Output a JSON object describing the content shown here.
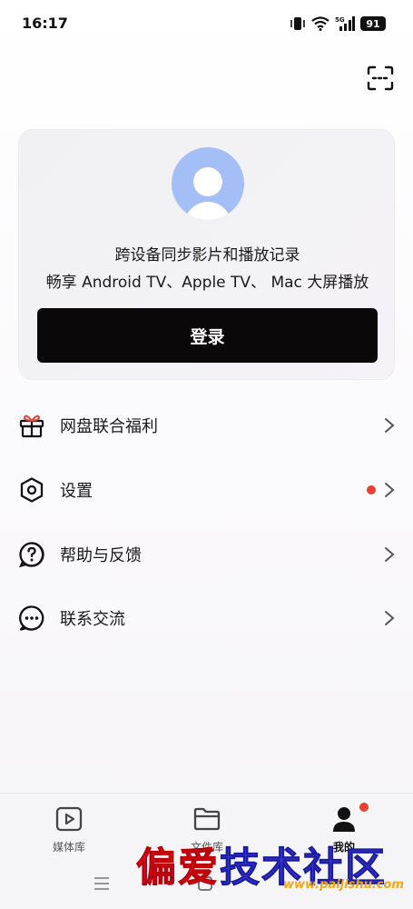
{
  "status_bar": {
    "time": "16:17",
    "network": "5G",
    "battery": "91"
  },
  "header": {
    "scan_icon": "scan-icon"
  },
  "login_card": {
    "avatar_icon": "user-avatar-icon",
    "line1": "跨设备同步影片和播放记录",
    "line2": "畅享 Android TV、Apple TV、 Mac 大屏播放",
    "login_label": "登录"
  },
  "menu": {
    "items": [
      {
        "icon": "gift-icon",
        "label": "网盘联合福利",
        "has_badge": false
      },
      {
        "icon": "settings-icon",
        "label": "设置",
        "has_badge": true
      },
      {
        "icon": "help-icon",
        "label": "帮助与反馈",
        "has_badge": false
      },
      {
        "icon": "chat-icon",
        "label": "联系交流",
        "has_badge": false
      }
    ]
  },
  "bottom_nav": {
    "tabs": [
      {
        "icon": "play-icon",
        "label": "媒体库",
        "active": false
      },
      {
        "icon": "folder-icon",
        "label": "文件库",
        "active": false
      },
      {
        "icon": "person-icon",
        "label": "我的",
        "active": true
      }
    ]
  },
  "watermark": {
    "text_red1": "偏",
    "text_red2": "爱",
    "text_blue": "技",
    "text_rest": "术社区",
    "url": "www.paijishu.com"
  },
  "colors": {
    "accent_dark": "#0a0809",
    "badge_red": "#e8412f",
    "avatar_blue": "#a4bff5"
  }
}
